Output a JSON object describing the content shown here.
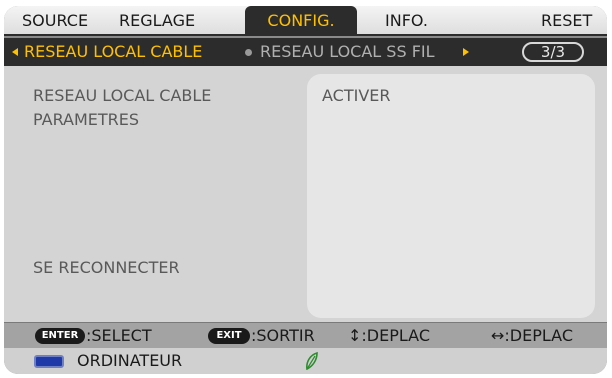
{
  "menu": {
    "tabs": [
      {
        "label": "SOURCE",
        "active": false
      },
      {
        "label": "REGLAGE",
        "active": false
      },
      {
        "label": "CONFIG.",
        "active": true
      },
      {
        "label": "INFO.",
        "active": false
      },
      {
        "label": "RESET",
        "active": false
      }
    ]
  },
  "subtabs": {
    "active": "RESEAU LOCAL CABLE",
    "next": "RESEAU LOCAL SS FIL",
    "page": "3/3"
  },
  "content": {
    "rows": [
      {
        "label": "RESEAU LOCAL CABLE",
        "value": "ACTIVER"
      },
      {
        "label": "PARAMETRES"
      },
      {
        "label": "SE RECONNECTER"
      }
    ]
  },
  "help": {
    "enter_key": "ENTER",
    "select": ":SELECT",
    "exit_key": "EXIT",
    "sortir": ":SORTIR",
    "updown": "↕:DEPLAC",
    "leftright": "↔:DEPLAC"
  },
  "source": {
    "name": "ORDINATEUR",
    "icon": "monitor-icon",
    "eco_icon": "leaf-icon"
  },
  "colors": {
    "accent": "#ffc000",
    "menu_active_bg": "#2c2c2c",
    "eco_green": "#2e8b2e"
  }
}
